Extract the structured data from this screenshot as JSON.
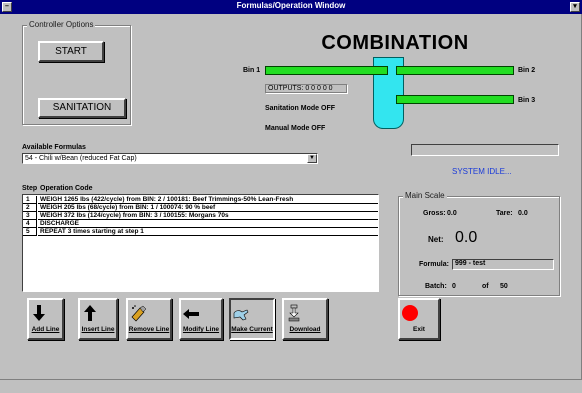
{
  "window": {
    "title": "Formulas/Operation Window",
    "sys_menu_icon": "system-menu-icon",
    "min_icon": "minimize-icon"
  },
  "controller": {
    "group_label": "Controller Options",
    "start_label": "START",
    "sanitation_label": "SANITATION"
  },
  "combination": {
    "title": "COMBINATION",
    "bin1": "Bin 1",
    "bin2": "Bin 2",
    "bin3": "Bin 3",
    "outputs": "OUTPUTS: 0 0 0 0 0",
    "sanitation_mode": "Sanitation Mode OFF",
    "manual_mode": "Manual Mode OFF",
    "bar_color": "#22dd22",
    "hopper_color": "#33e5ef"
  },
  "formulas": {
    "label": "Available Formulas",
    "selected": "54 - Chili w/Bean (reduced Fat Cap)"
  },
  "status": {
    "system_text": "SYSTEM IDLE...",
    "text_color": "#1a3ad8"
  },
  "steps": {
    "header_step": "Step",
    "header_op": "Operation Code",
    "rows": [
      {
        "step": "1",
        "op": "WEIGH 1265 lbs (422/cycle) from BIN: 2 / 100181: Beef Trimmings-50% Lean-Fresh"
      },
      {
        "step": "2",
        "op": "WEIGH 205 lbs (68/cycle) from BIN: 1 / 100074: 90 % beef"
      },
      {
        "step": "3",
        "op": "WEIGH 372 lbs (124/cycle) from BIN: 3 / 100155: Morgans 70s"
      },
      {
        "step": "4",
        "op": "DISCHARGE"
      },
      {
        "step": "5",
        "op": "REPEAT 3 times starting at step 1"
      }
    ]
  },
  "scale": {
    "group_label": "Main Scale",
    "gross_label": "Gross:",
    "gross_value": "0.0",
    "tare_label": "Tare:",
    "tare_value": "0.0",
    "net_label": "Net:",
    "net_value": "0.0",
    "formula_label": "Formula:",
    "formula_value": "999 - test",
    "batch_label": "Batch:",
    "batch_value": "0",
    "of_label": "of",
    "of_value": "50"
  },
  "toolbar": {
    "add_line": "Add Line",
    "insert_line": "Insert Line",
    "remove_line": "Remove Line",
    "modify_line": "Modify Line",
    "make_current": "Make Current",
    "download": "Download",
    "exit": "Exit",
    "exit_color": "#ff0000"
  }
}
